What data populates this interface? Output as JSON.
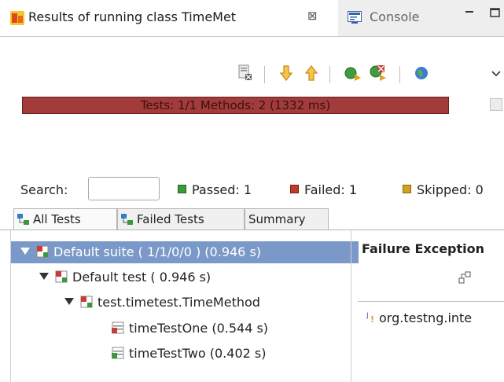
{
  "view_tab": {
    "title": "Results of running class TimeMet",
    "close_glyph": "⊠"
  },
  "console_tab": {
    "title": "Console"
  },
  "progress": {
    "label": "Tests: 1/1  Methods: 2 (1332 ms)",
    "fraction": 1.0,
    "color": "#a23b3b"
  },
  "search": {
    "label": "Search:",
    "value": ""
  },
  "counts": {
    "passed": "Passed: 1",
    "failed": "Failed: 1",
    "skipped": "Skipped: 0"
  },
  "tabs": {
    "all": "All Tests",
    "failed": "Failed Tests",
    "summary": "Summary"
  },
  "tree": {
    "suite": "Default suite ( 1/1/0/0 ) (0.946 s)",
    "test": "Default test ( 0.946 s)",
    "class": "test.timetest.TimeMethod",
    "m1_name": "timeTestOne",
    "m1_time": "(0.544 s)",
    "m2_name": "timeTestTwo",
    "m2_time": "(0.402 s)"
  },
  "failure": {
    "header": "Failure Exception",
    "entry": "org.testng.inte"
  },
  "colors": {
    "selection": "#7a99c8",
    "pass": "#3a9a3a",
    "fail": "#c0392b",
    "skip": "#d4a020"
  }
}
